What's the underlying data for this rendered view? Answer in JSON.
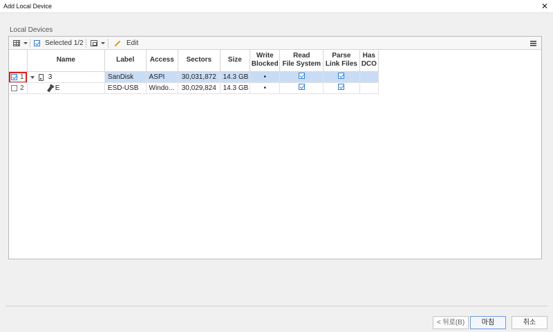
{
  "window": {
    "title": "Add Local Device",
    "close_glyph": "✕"
  },
  "group_label": "Local Devices",
  "toolbar": {
    "selected_label": "Selected 1/2",
    "edit_label": "Edit"
  },
  "table": {
    "headers": {
      "name": "Name",
      "label": "Label",
      "access": "Access",
      "sectors": "Sectors",
      "size": "Size",
      "write_blocked_1": "Write",
      "write_blocked_2": "Blocked",
      "read_fs_1": "Read",
      "read_fs_2": "File System",
      "parse_link_1": "Parse",
      "parse_link_2": "Link Files",
      "has_dco_1": "Has",
      "has_dco_2": "DCO"
    },
    "rows": [
      {
        "num": "1",
        "checked": true,
        "selected": true,
        "expanded": true,
        "icon": "drive-icon",
        "name": "3",
        "label": "SanDisk",
        "access": "ASPI",
        "sectors": "30,031,872",
        "size": "14.3 GB",
        "write_blocked": "•",
        "read_fs": true,
        "parse_link": true,
        "has_dco": ""
      },
      {
        "num": "2",
        "checked": false,
        "selected": false,
        "expanded": false,
        "icon": "usb-icon",
        "name": "E",
        "label": "ESD-USB",
        "access": "Windo...",
        "sectors": "30,029,824",
        "size": "14.3 GB",
        "write_blocked": "•",
        "read_fs": true,
        "parse_link": true,
        "has_dco": ""
      }
    ]
  },
  "buttons": {
    "back": "< 뒤로(B)",
    "finish": "마침",
    "cancel": "취소"
  },
  "colors": {
    "selection": "#c9dcf5",
    "highlight_box": "#d92020",
    "accent": "#2f7fd0"
  }
}
